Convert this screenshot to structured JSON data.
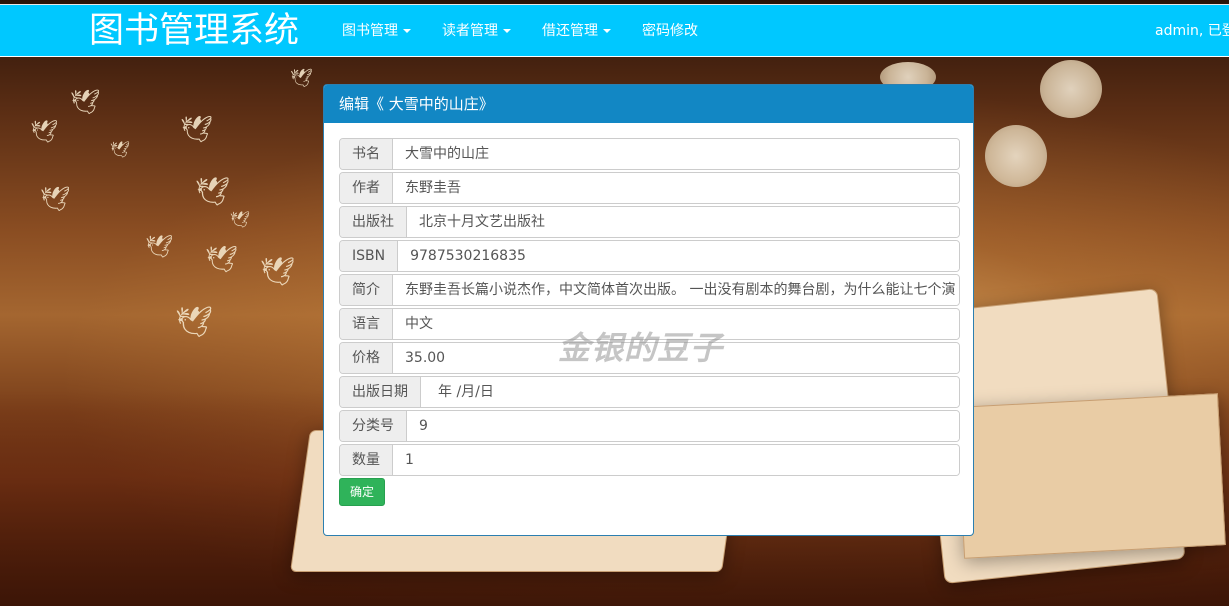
{
  "navbar": {
    "brand": "图书管理系统",
    "items": [
      {
        "label": "图书管理",
        "dropdown": true
      },
      {
        "label": "读者管理",
        "dropdown": true
      },
      {
        "label": "借还管理",
        "dropdown": true
      },
      {
        "label": "密码修改",
        "dropdown": false
      }
    ],
    "user_text": "admin, 已登"
  },
  "panel": {
    "title": "编辑《 大雪中的山庄》",
    "fields": [
      {
        "label": "书名",
        "value": "大雪中的山庄"
      },
      {
        "label": "作者",
        "value": "东野圭吾"
      },
      {
        "label": "出版社",
        "value": "北京十月文艺出版社"
      },
      {
        "label": "ISBN",
        "value": "9787530216835"
      },
      {
        "label": "简介",
        "value": "东野圭吾长篇小说杰作，中文简体首次出版。 一出没有剧本的舞台剧，为什么能让七个演"
      },
      {
        "label": "语言",
        "value": "中文"
      },
      {
        "label": "价格",
        "value": "35.00"
      },
      {
        "label": "出版日期",
        "value": "年 /月/日"
      },
      {
        "label": "分类号",
        "value": "9"
      },
      {
        "label": "数量",
        "value": "1"
      }
    ],
    "submit_label": "确定"
  },
  "watermark": "金银的豆子",
  "colors": {
    "navbar": "#00c8ff",
    "panel_heading": "#1287c4",
    "submit_button": "#2fb35a"
  }
}
